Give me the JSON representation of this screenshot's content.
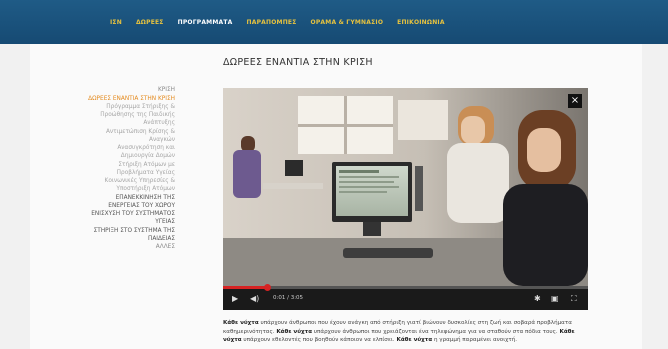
{
  "nav": {
    "items": [
      {
        "label": "ΙΣΝ",
        "active": false
      },
      {
        "label": "ΔΩΡΕΕΣ",
        "active": false
      },
      {
        "label": "ΠΡΟΓΡΑΜΜΑΤΑ",
        "active": true
      },
      {
        "label": "ΠΑΡΑΠΟΜΠΕΣ",
        "active": false
      },
      {
        "label": "ΟΡΑΜΑ & ΓΥΜΝΑΣΙΟ",
        "active": false
      },
      {
        "label": "ΕΠΙΚΟΙΝΩΝΙΑ",
        "active": false
      }
    ]
  },
  "page": {
    "title": "ΔΩΡΕΕΣ ΕΝΑΝΤΙΑ ΣΤΗΝ ΚΡΙΣΗ"
  },
  "sidebar": {
    "items": [
      {
        "label": "ΚΡΙΣΗ",
        "kind": "normal"
      },
      {
        "label": "ΔΩΡΕΕΣ ΕΝΑΝΤΙΑ ΣΤΗΝ ΚΡΙΣΗ",
        "kind": "active"
      },
      {
        "label": "Πρόγραμμα Στήριξης & Προώθησης της Παιδικής Ανάπτυξης",
        "kind": "sub"
      },
      {
        "label": "Αντιμετώπιση Κρίσης & Αναγκών",
        "kind": "sub"
      },
      {
        "label": "Ανασυγκρότηση και Δημιουργία Δομών",
        "kind": "sub"
      },
      {
        "label": "Στήριξη Ατόμων με Προβλήματα Υγείας",
        "kind": "sub"
      },
      {
        "label": "Κοινωνικές Υπηρεσίες & Υποστήριξη Ατόμων",
        "kind": "sub"
      },
      {
        "label": "ΕΠΑΝΕΚΚΙΝΗΣΗ ΤΗΣ ΕΝΕΡΓΕΙΑΣ ΤΟΥ ΧΩΡΟΥ",
        "kind": "top"
      },
      {
        "label": "ΕΝΙΣΧΥΣΗ ΤΟΥ ΣΥΣΤΗΜΑΤΟΣ ΥΓΕΙΑΣ",
        "kind": "top"
      },
      {
        "label": "ΣΤΗΡΙΞΗ ΣΤΟ ΣΥΣΤΗΜΑ ΤΗΣ ΠΑΙΔΕΙΑΣ",
        "kind": "top"
      },
      {
        "label": "ΑΛΛΕΣ",
        "kind": "normal"
      }
    ]
  },
  "video": {
    "close_symbol": "×",
    "time": "0:01 / 3:05",
    "progress": 0.12
  },
  "body": {
    "lead": "Κάθε νύχτα",
    "text1": " υπάρχουν άνθρωποι που έχουν ανάγκη από στήριξη γιατί βιώνουν δυσκολίες στη ζωή και σοβαρά προβλήματα καθημερινότητας. ",
    "bold2": "Κάθε νύχτα",
    "text2": " υπάρχουν άνθρωποι που χρειάζονται ένα τηλεφώνημα για να σταθούν στα πόδια τους. ",
    "bold3": "Κάθε νύχτα",
    "text3": " υπάρχουν εθελοντές που βοηθούν κάποιον να ελπίσει.",
    "bold4": " Κάθε νύχτα",
    "text4": " η γραμμή παραμένει ανοιχτή."
  },
  "colors": {
    "nav_bg": "#1a517b",
    "nav_text": "#e7c23e",
    "accent": "#e48a1d",
    "progress": "#d62323"
  }
}
